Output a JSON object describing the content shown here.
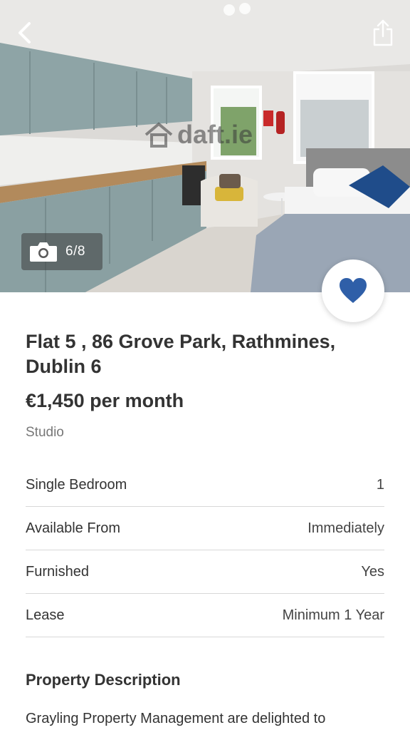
{
  "hero": {
    "photo_counter": "6/8",
    "watermark": "daft.ie",
    "icons": {
      "back": "chevron-left-icon",
      "share": "share-icon",
      "camera": "camera-icon"
    }
  },
  "favourite": {
    "icon": "heart-icon",
    "color": "#2f5fa8",
    "active": true
  },
  "listing": {
    "address": "Flat 5 , 86 Grove Park, Rathmines, Dublin 6",
    "price": "€1,450 per month",
    "property_type": "Studio"
  },
  "details": [
    {
      "label": "Single Bedroom",
      "value": "1"
    },
    {
      "label": "Available From",
      "value": "Immediately"
    },
    {
      "label": "Furnished",
      "value": "Yes"
    },
    {
      "label": "Lease",
      "value": "Minimum 1 Year"
    }
  ],
  "description": {
    "title": "Property Description",
    "text": "Grayling Property Management are delighted to"
  }
}
